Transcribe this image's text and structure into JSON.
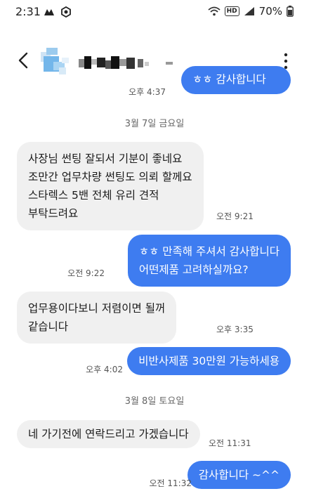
{
  "status_bar": {
    "time": "2:31",
    "battery": "70%",
    "hd_label": "HD"
  },
  "header": {
    "back_icon": "chevron-left-icon",
    "more_icon": "more-vert-icon"
  },
  "messages": [
    {
      "dir": "out",
      "text": "ㅎㅎ 감사합니다",
      "time": "오후 4:37"
    },
    {
      "type": "date",
      "text": "3월 7일 금요일"
    },
    {
      "dir": "in",
      "text": "사장님 썬팅 잘되서 기분이 좋네요\n조만간 업무차량 썬팅도 의뢰 할께요\n스타렉스 5밴 전체 유리 견적\n부탁드려요",
      "time": "오전 9:21"
    },
    {
      "dir": "out",
      "text": "ㅎㅎ 만족해 주셔서 감사합니다\n어떤제품 고려하실까요?",
      "time": "오전 9:22"
    },
    {
      "dir": "in",
      "text": "업무용이다보니 저렴이면 될꺼\n같습니다",
      "time": "오후 3:35"
    },
    {
      "dir": "out",
      "text": "비반사제품 30만원 가능하세용",
      "time": "오후 4:02"
    },
    {
      "type": "date",
      "text": "3월 8일 토요일"
    },
    {
      "dir": "in",
      "text": "네 가기전에 연락드리고 가겠습니다",
      "time": "오전 11:31"
    },
    {
      "dir": "out",
      "text": "감사합니다 ~^^",
      "time": "오전 11:32"
    }
  ]
}
